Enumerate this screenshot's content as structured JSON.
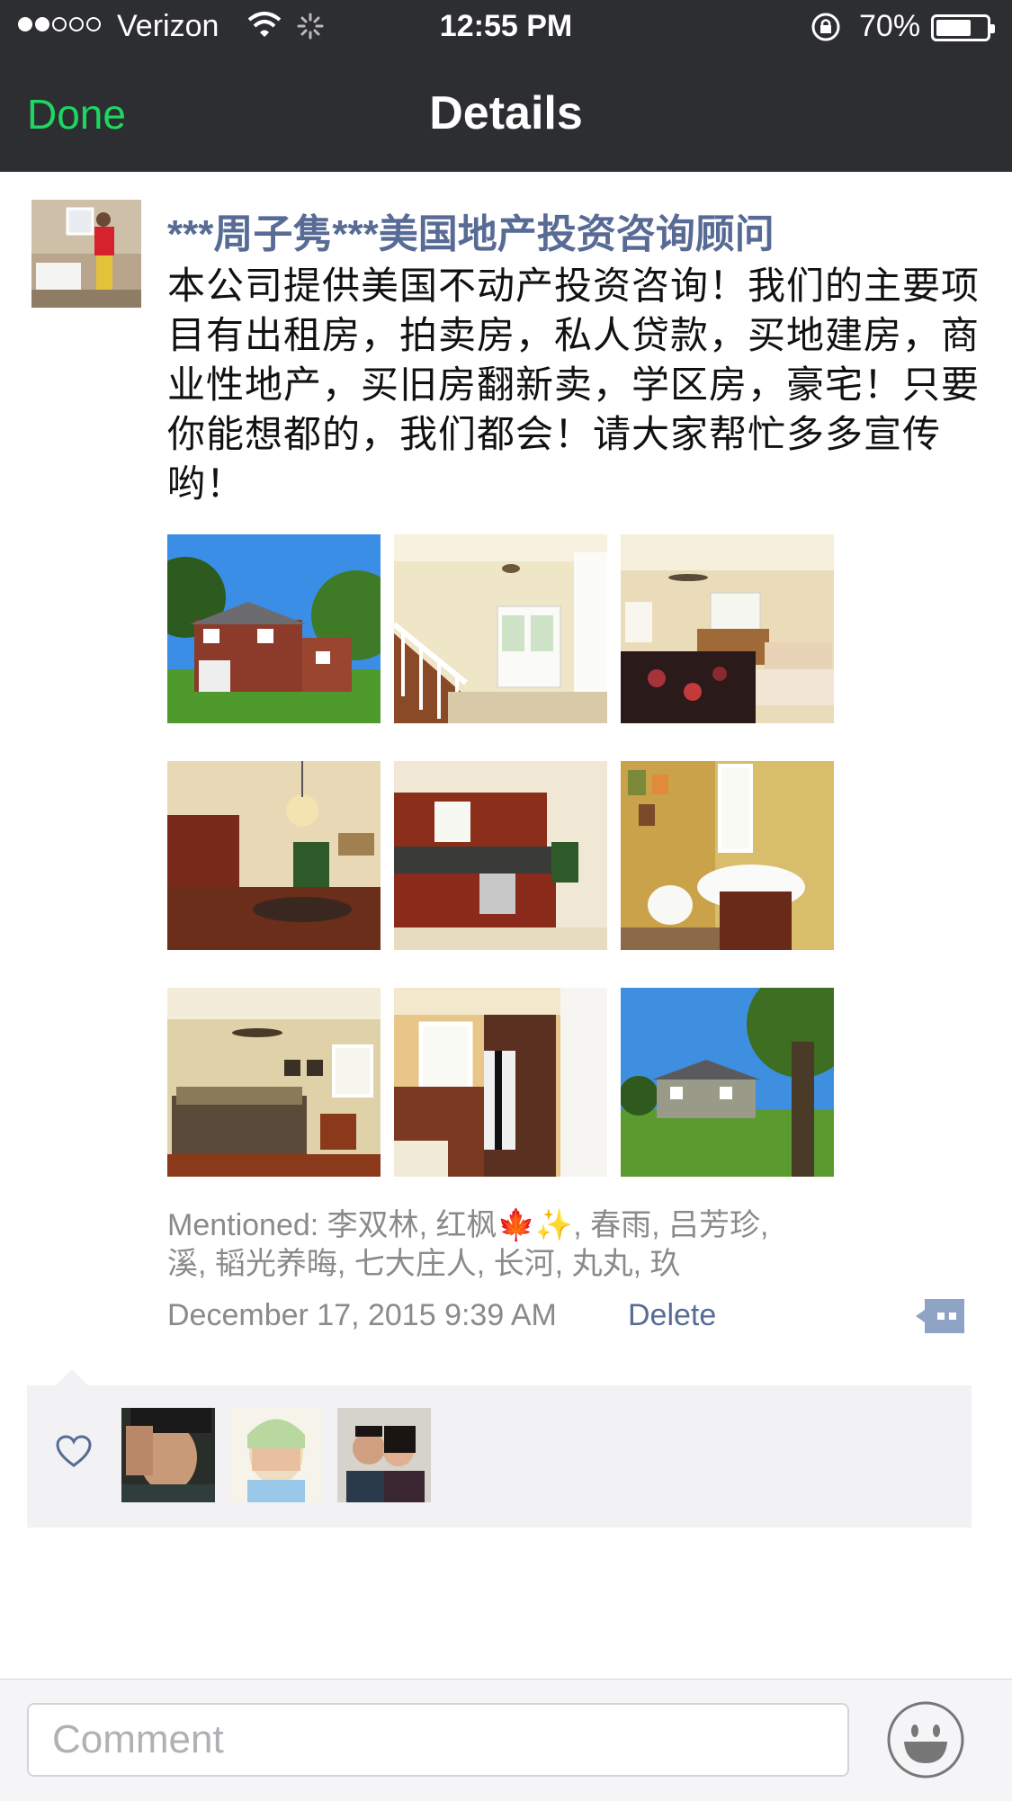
{
  "status_bar": {
    "carrier": "Verizon",
    "time": "12:55 PM",
    "battery_percent": "70%",
    "battery_level": 0.7,
    "signal_bars": 2
  },
  "nav": {
    "done_label": "Done",
    "title": "Details"
  },
  "post": {
    "author": "***周子隽***美国地产投资咨询顾问",
    "text": "本公司提供美国不动产投资咨询！我们的主要项目有出租房，拍卖房，私人贷款，买地建房，商业性地产，买旧房翻新卖，学区房，豪宅！只要你能想都的，我们都会！请大家帮忙多多宣传哟！",
    "photos": [
      {
        "name": "house-exterior-front"
      },
      {
        "name": "entry-staircase"
      },
      {
        "name": "living-room"
      },
      {
        "name": "dining-kitchen"
      },
      {
        "name": "kitchen"
      },
      {
        "name": "bathroom-sink"
      },
      {
        "name": "bedroom"
      },
      {
        "name": "bathroom-tub"
      },
      {
        "name": "house-exterior-back"
      }
    ],
    "mentioned_line1": "Mentioned: 李双林, 红枫🍁✨, 春雨, 吕芳珍,",
    "mentioned_line2": "溪, 韬光养晦, 七大庄人, 长河, 丸丸, 玖",
    "timestamp": "December 17, 2015 9:39 AM",
    "delete_label": "Delete"
  },
  "likes": {
    "icon": "heart-icon",
    "users": [
      {
        "name": "liker-avatar-1"
      },
      {
        "name": "liker-avatar-2"
      },
      {
        "name": "liker-avatar-3"
      }
    ]
  },
  "comment_bar": {
    "placeholder": "Comment",
    "emoji_icon": "smiley-icon"
  },
  "colors": {
    "nav_bg": "#2d2e32",
    "done_green": "#1ed760",
    "link_blue": "#576b95",
    "likes_bg": "#f2f2f5"
  }
}
